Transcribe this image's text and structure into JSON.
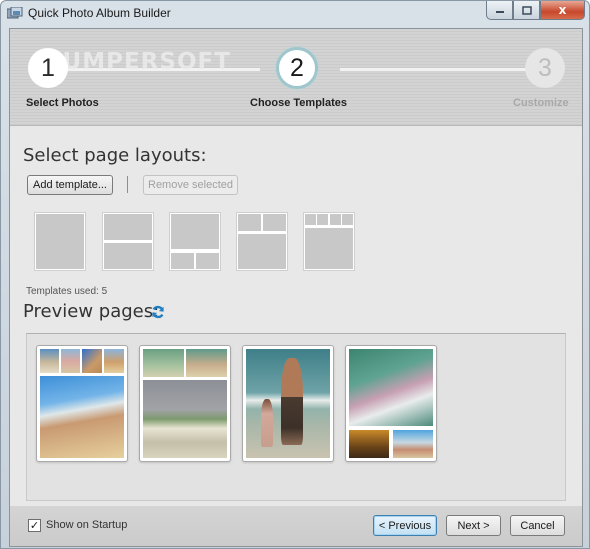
{
  "window": {
    "title": "Quick Photo Album Builder",
    "controls": {
      "minimize": "minimize",
      "maximize": "maximize",
      "close": "x"
    }
  },
  "wizard": {
    "watermark": "BUMPERSOFT",
    "steps": [
      {
        "number": "1",
        "label": "Select Photos",
        "state": "done"
      },
      {
        "number": "2",
        "label": "Choose Templates",
        "state": "active"
      },
      {
        "number": "3",
        "label": "Customize",
        "state": "todo"
      }
    ]
  },
  "layouts": {
    "title": "Select page layouts:",
    "add_button": "Add template...",
    "remove_button": "Remove selected",
    "templates": [
      {
        "name": "single"
      },
      {
        "name": "two-horizontal"
      },
      {
        "name": "one-top-two-bottom"
      },
      {
        "name": "two-top-one-bottom"
      },
      {
        "name": "four-top-one-bottom"
      }
    ],
    "templates_used_label": "Templates used: 5"
  },
  "preview": {
    "title": "Preview pages:",
    "refresh_icon": "refresh-icon",
    "pages": [
      {
        "name": "page-1",
        "layout": "four-top-one-bottom"
      },
      {
        "name": "page-2",
        "layout": "two-top-one-bottom"
      },
      {
        "name": "page-3",
        "layout": "single"
      },
      {
        "name": "page-4",
        "layout": "one-top-two-bottom"
      }
    ]
  },
  "footer": {
    "show_on_startup_label": "Show on Startup",
    "show_on_startup_checked": true,
    "check_glyph": "✓",
    "previous_button": "< Previous",
    "next_button": "Next >",
    "cancel_button": "Cancel"
  }
}
